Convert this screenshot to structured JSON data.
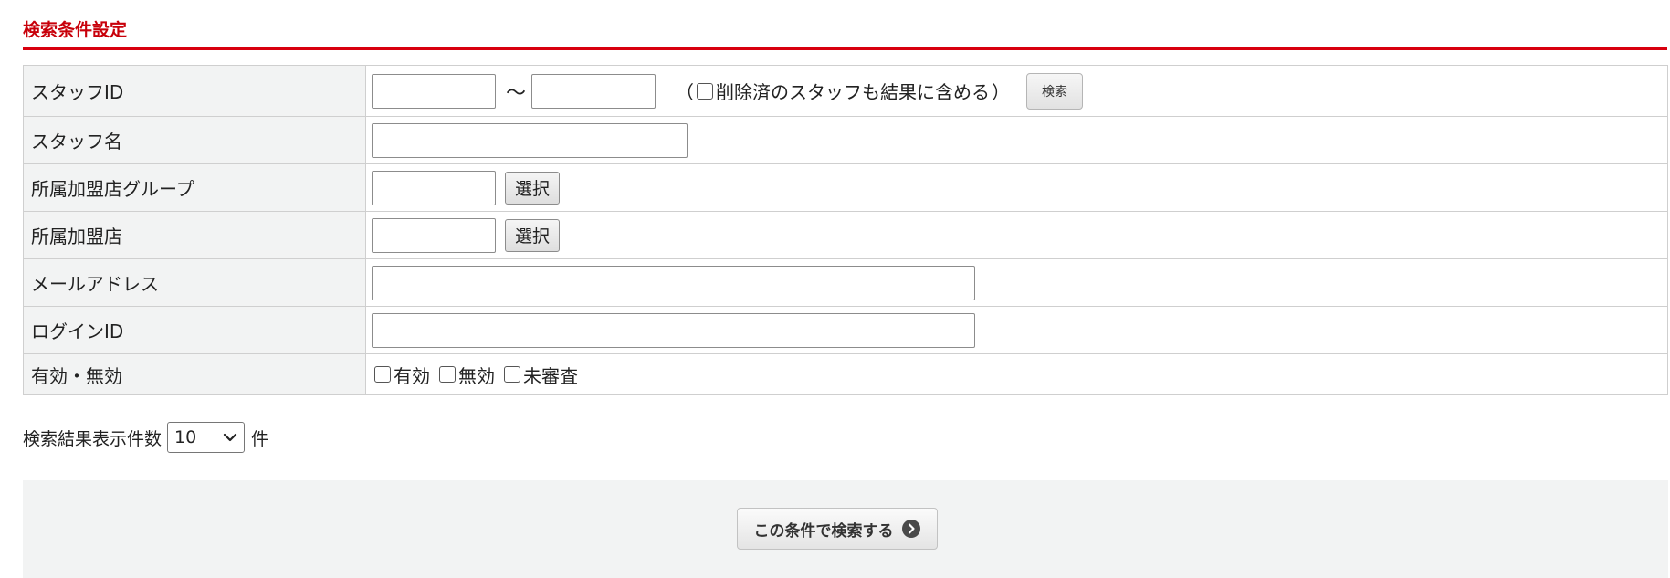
{
  "section": {
    "title": "検索条件設定"
  },
  "form": {
    "rows": {
      "staff_id": {
        "label": "スタッフID",
        "from_value": "",
        "to_value": "",
        "range_separator": "～",
        "paren_open": "（",
        "paren_close": "）",
        "include_deleted_label": "削除済のスタッフも結果に含める",
        "include_deleted_checked": false,
        "search_button_label": "検索"
      },
      "staff_name": {
        "label": "スタッフ名",
        "value": ""
      },
      "store_group": {
        "label": "所属加盟店グループ",
        "value": "",
        "select_button_label": "選択"
      },
      "store": {
        "label": "所属加盟店",
        "value": "",
        "select_button_label": "選択"
      },
      "email": {
        "label": "メールアドレス",
        "value": ""
      },
      "login_id": {
        "label": "ログインID",
        "value": ""
      },
      "status": {
        "label": "有効・無効",
        "options": [
          {
            "label": "有効",
            "checked": false
          },
          {
            "label": "無効",
            "checked": false
          },
          {
            "label": "未審査",
            "checked": false
          }
        ]
      }
    }
  },
  "page_size": {
    "label": "検索結果表示件数",
    "selected": "10",
    "unit": "件"
  },
  "submit": {
    "label": "この条件で検索する",
    "icon": "chevron-right-circle-icon"
  },
  "colors": {
    "accent": "#d8000f",
    "title_text": "#c8000a",
    "label_cell_bg": "#f2f3f3",
    "border": "#cfcfcf"
  }
}
